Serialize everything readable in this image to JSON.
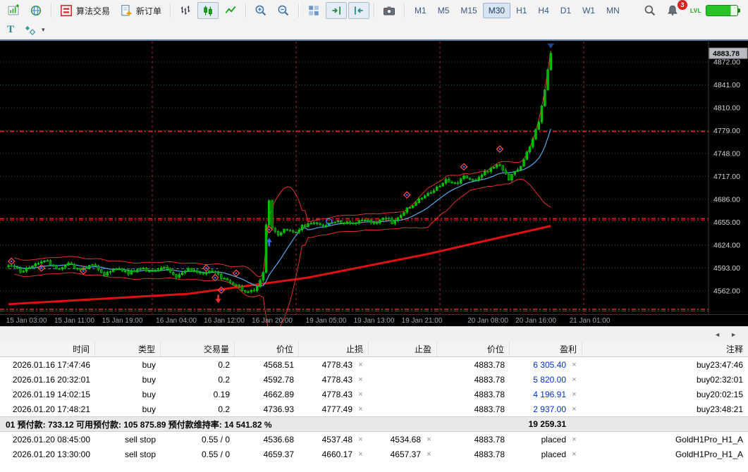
{
  "toolbar": {
    "algo_trading_label": "算法交易",
    "new_order_label": "新订单",
    "timeframes": [
      "M1",
      "M5",
      "M15",
      "M30",
      "H1",
      "H4",
      "D1",
      "W1",
      "MN"
    ],
    "active_timeframe": "M30",
    "notification_badge": "3",
    "level_indicator_label": "LVL"
  },
  "drawing_toolbar": {
    "text_tool_label": "T",
    "dropdown_caret": "▾"
  },
  "chart_scrollbar": {
    "left_arrow": "◄",
    "right_arrow": "►"
  },
  "chart": {
    "type": "candlestick",
    "bars": 182,
    "noise": 2.2,
    "current_price": "4883.78",
    "current_price_value": 4883.78,
    "price_labels": [
      "4872.00",
      "4841.00",
      "4810.00",
      "4779.00",
      "4748.00",
      "4717.00",
      "4686.00",
      "4655.00",
      "4624.00",
      "4593.00",
      "4562.00"
    ],
    "time_labels": [
      {
        "bar": 6,
        "label": "15 Jan 03:00"
      },
      {
        "bar": 22,
        "label": "15 Jan 11:00"
      },
      {
        "bar": 38,
        "label": "15 Jan 19:00"
      },
      {
        "bar": 56,
        "label": "16 Jan 04:00"
      },
      {
        "bar": 72,
        "label": "16 Jan 12:00"
      },
      {
        "bar": 88,
        "label": "16 Jan 20:00"
      },
      {
        "bar": 106,
        "label": "19 Jan 05:00"
      },
      {
        "bar": 122,
        "label": "19 Jan 13:00"
      },
      {
        "bar": 138,
        "label": "19 Jan 21:00"
      },
      {
        "bar": 160,
        "label": "20 Jan 08:00"
      },
      {
        "bar": 176,
        "label": "20 Jan 16:00"
      },
      {
        "bar": 194,
        "label": "21 Jan 01:00"
      }
    ],
    "day_separator_bars": [
      48,
      96,
      144,
      192
    ],
    "order_line_prices": [
      4778.43,
      4777.49,
      4660.17,
      4659.37,
      4657.37,
      4537.48,
      4536.68,
      4534.68
    ],
    "order_segment": {
      "price": 4592,
      "from_bar": 0,
      "to_bar": 70
    },
    "trend_line": [
      [
        0,
        4544
      ],
      [
        60,
        4558
      ],
      [
        100,
        4580
      ],
      [
        140,
        4612
      ],
      [
        181,
        4650
      ]
    ],
    "close_anchors": [
      [
        0,
        4598
      ],
      [
        4,
        4588
      ],
      [
        8,
        4596
      ],
      [
        12,
        4604
      ],
      [
        16,
        4592
      ],
      [
        20,
        4599
      ],
      [
        24,
        4590
      ],
      [
        28,
        4597
      ],
      [
        32,
        4585
      ],
      [
        36,
        4593
      ],
      [
        40,
        4586
      ],
      [
        44,
        4592
      ],
      [
        48,
        4589
      ],
      [
        52,
        4595
      ],
      [
        56,
        4582
      ],
      [
        60,
        4591
      ],
      [
        64,
        4585
      ],
      [
        68,
        4589
      ],
      [
        72,
        4578
      ],
      [
        76,
        4568
      ],
      [
        80,
        4560
      ],
      [
        83,
        4566
      ],
      [
        85,
        4585
      ],
      [
        86,
        4652
      ],
      [
        87,
        4686
      ],
      [
        88,
        4648
      ],
      [
        90,
        4636
      ],
      [
        92,
        4645
      ],
      [
        95,
        4640
      ],
      [
        98,
        4649
      ],
      [
        102,
        4655
      ],
      [
        106,
        4650
      ],
      [
        110,
        4657
      ],
      [
        114,
        4653
      ],
      [
        118,
        4659
      ],
      [
        122,
        4654
      ],
      [
        126,
        4661
      ],
      [
        128,
        4655
      ],
      [
        131,
        4666
      ],
      [
        134,
        4676
      ],
      [
        137,
        4686
      ],
      [
        140,
        4694
      ],
      [
        143,
        4703
      ],
      [
        146,
        4712
      ],
      [
        149,
        4706
      ],
      [
        152,
        4716
      ],
      [
        155,
        4710
      ],
      [
        158,
        4720
      ],
      [
        161,
        4728
      ],
      [
        163,
        4734
      ],
      [
        165,
        4726
      ],
      [
        167,
        4714
      ],
      [
        169,
        4722
      ],
      [
        171,
        4730
      ],
      [
        173,
        4748
      ],
      [
        175,
        4766
      ],
      [
        177,
        4792
      ],
      [
        178,
        4812
      ],
      [
        179,
        4836
      ],
      [
        180,
        4862
      ],
      [
        181,
        4884
      ]
    ],
    "markers": [
      {
        "bar": 1,
        "price": 4602,
        "type": "diamond"
      },
      {
        "bar": 11,
        "price": 4593,
        "type": "diamond"
      },
      {
        "bar": 25,
        "price": 4589,
        "type": "diamond"
      },
      {
        "bar": 66,
        "price": 4593,
        "type": "diamond"
      },
      {
        "bar": 69,
        "price": 4580,
        "type": "diamond"
      },
      {
        "bar": 70,
        "price": 4551,
        "type": "arrow-down"
      },
      {
        "bar": 71,
        "price": 4563,
        "type": "diamond"
      },
      {
        "bar": 76,
        "price": 4586,
        "type": "diamond"
      },
      {
        "bar": 87,
        "price": 4628,
        "type": "arrow-up"
      },
      {
        "bar": 87,
        "price": 4645,
        "type": "diamond"
      },
      {
        "bar": 107,
        "price": 4656,
        "type": "circle"
      },
      {
        "bar": 133,
        "price": 4692,
        "type": "diamond"
      },
      {
        "bar": 152,
        "price": 4730,
        "type": "diamond"
      },
      {
        "bar": 164,
        "price": 4754,
        "type": "diamond"
      },
      {
        "bar": 181,
        "price": 4897,
        "type": "top-triangle"
      }
    ],
    "colors": {
      "background": "#000000",
      "candle_up": "#00b400",
      "candle_down": "#007800",
      "candle_border": "#00d800",
      "grid": "#1e5c1e",
      "ma_line": "#58a8e8",
      "band_line": "#e03030",
      "trend_line": "#dd1111",
      "order_line": "#cc2222",
      "order_segment": "#4466ee",
      "day_separator": "#a03030",
      "axis_text": "#d0d4d8",
      "time_text": "#9aa4ae",
      "current_price_box": "#b8bcc2"
    }
  },
  "positions": {
    "headers": [
      "时间",
      "类型",
      "交易量",
      "价位",
      "止损",
      "止盈",
      "价位",
      "盈利",
      "注释"
    ],
    "open": [
      {
        "time": "2026.01.16 17:47:46",
        "type": "buy",
        "volume": "0.2",
        "price": "4568.51",
        "sl": "4778.43",
        "sl_x": true,
        "tp": "",
        "price2": "4883.78",
        "profit": "6 305.40",
        "profit_x": true,
        "profit_blue": true,
        "comment": "buy23:47:46"
      },
      {
        "time": "2026.01.16 20:32:01",
        "type": "buy",
        "volume": "0.2",
        "price": "4592.78",
        "sl": "4778.43",
        "sl_x": true,
        "tp": "",
        "price2": "4883.78",
        "profit": "5 820.00",
        "profit_x": true,
        "profit_blue": true,
        "comment": "buy02:32:01"
      },
      {
        "time": "2026.01.19 14:02:15",
        "type": "buy",
        "volume": "0.19",
        "price": "4662.89",
        "sl": "4778.43",
        "sl_x": true,
        "tp": "",
        "price2": "4883.78",
        "profit": "4 196.91",
        "profit_x": true,
        "profit_blue": true,
        "comment": "buy20:02:15"
      },
      {
        "time": "2026.01.20 17:48:21",
        "type": "buy",
        "volume": "0.2",
        "price": "4736.93",
        "sl": "4777.49",
        "sl_x": true,
        "tp": "",
        "price2": "4883.78",
        "profit": "2 937.00",
        "profit_x": true,
        "profit_blue": true,
        "comment": "buy23:48:21"
      }
    ],
    "summary": {
      "account_text": "01  预付款: 733.12  可用预付款: 105 875.89  预付款维持率: 14 541.82 %",
      "total_profit": "19 259.31"
    },
    "pending": [
      {
        "time": "2026.01.20 08:45:00",
        "type": "sell stop",
        "volume": "0.55 / 0",
        "price": "4536.68",
        "sl": "4537.48",
        "sl_x": true,
        "tp": "4534.68",
        "tp_x": true,
        "price2": "4883.78",
        "profit": "placed",
        "profit_x": true,
        "profit_blue": false,
        "comment": "GoldH1Pro_H1_A"
      },
      {
        "time": "2026.01.20 13:30:00",
        "type": "sell stop",
        "volume": "0.55 / 0",
        "price": "4659.37",
        "sl": "4660.17",
        "sl_x": true,
        "tp": "4657.37",
        "tp_x": true,
        "price2": "4883.78",
        "profit": "placed",
        "profit_x": true,
        "profit_blue": false,
        "comment": "GoldH1Pro_H1_A"
      }
    ]
  }
}
